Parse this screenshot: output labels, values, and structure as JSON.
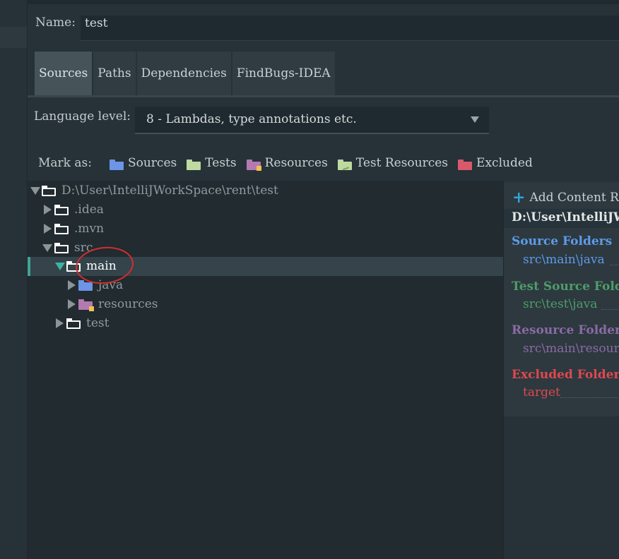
{
  "name_field": {
    "label": "Name:",
    "value": "test"
  },
  "tabs": [
    {
      "label": "Sources",
      "active": true
    },
    {
      "label": "Paths",
      "active": false
    },
    {
      "label": "Dependencies",
      "active": false
    },
    {
      "label": "FindBugs-IDEA",
      "active": false
    }
  ],
  "language_level": {
    "label": "Language level:",
    "value": "8 - Lambdas, type annotations etc."
  },
  "mark_as": {
    "label": "Mark as:",
    "items": [
      {
        "label": "Sources",
        "color": "#6d94e6"
      },
      {
        "label": "Tests",
        "color": "#bfd9a0"
      },
      {
        "label": "Resources",
        "color": "#b27ab0"
      },
      {
        "label": "Test Resources",
        "color": "#bfd9a0"
      },
      {
        "label": "Excluded",
        "color": "#d9596b"
      }
    ]
  },
  "tree": {
    "nodes": [
      {
        "label": "D:\\User\\IntelliJWorkSpace\\rent\\test",
        "expanded": true
      },
      {
        "label": ".idea",
        "expanded": false
      },
      {
        "label": ".mvn",
        "expanded": false
      },
      {
        "label": "src",
        "expanded": true
      },
      {
        "label": "main",
        "expanded": true,
        "selected": true
      },
      {
        "label": "java",
        "expanded": false,
        "icon": "source-folder-icon"
      },
      {
        "label": "resources",
        "expanded": false,
        "icon": "resource-folder-icon"
      },
      {
        "label": "test",
        "expanded": false
      }
    ]
  },
  "content_root": {
    "add_label": "Add Content Ro",
    "path": "D:\\User\\IntelliJW",
    "groups": [
      {
        "heading": "Source Folders",
        "item": "src\\main\\java",
        "color": "#5e9bea",
        "item_color": "#5e9bea"
      },
      {
        "heading": "Test Source Folde",
        "item": "src\\test\\java",
        "color": "#4f9c6a",
        "item_color": "#4f9c6a"
      },
      {
        "heading": "Resource Folders",
        "item": "src\\main\\resour",
        "color": "#8b6aa6",
        "item_color": "#8b6aa6"
      },
      {
        "heading": "Excluded Folders",
        "item": "target",
        "color": "#e0484f",
        "item_color": "#e0484f"
      }
    ]
  }
}
